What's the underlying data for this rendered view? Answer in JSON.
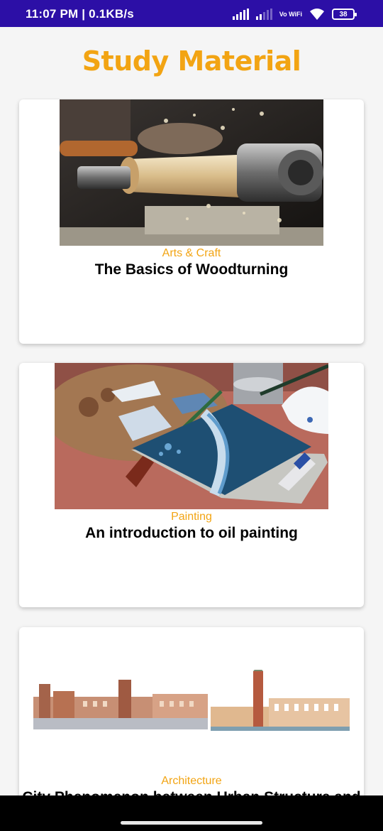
{
  "status_bar": {
    "time": "11:07 PM | 0.1KB/s",
    "vowifi": "Vo WiFi",
    "battery": "38"
  },
  "header": {
    "title": "Study Material",
    "accent_color": "#f2a413"
  },
  "courses": [
    {
      "category": "Arts & Craft",
      "title": "The Basics of Woodturning",
      "image": "woodturning-lathe-photo"
    },
    {
      "category": "Painting",
      "title": "An introduction to oil painting",
      "image": "oil-painting-canvas-photo"
    },
    {
      "category": "Architecture",
      "title": "City Phenomenon between Urban Structure and",
      "image": "city-panorama-photo"
    }
  ]
}
